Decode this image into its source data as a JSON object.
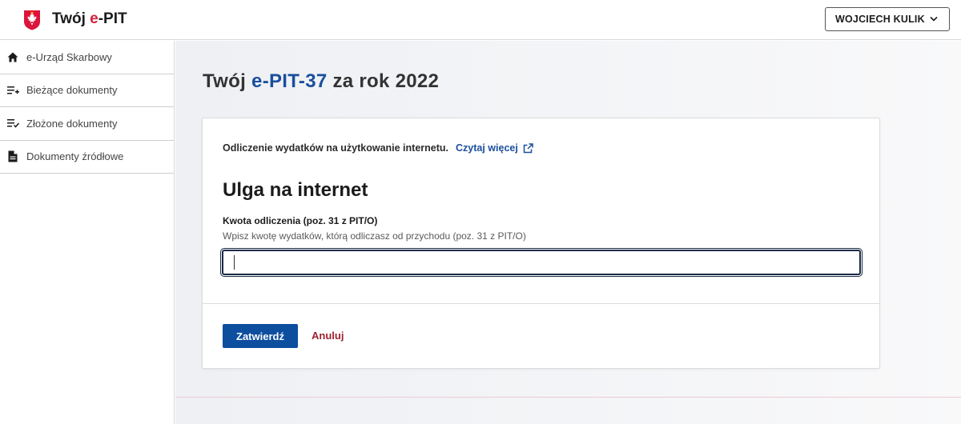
{
  "header": {
    "logo_prefix": "Twój ",
    "logo_accent": "e",
    "logo_suffix": "-PIT",
    "logo_icon": "polish-eagle-emblem",
    "user_name": "WOJCIECH KULIK",
    "user_menu_icon": "chevron-down-icon"
  },
  "sidebar": {
    "items": [
      {
        "label": "e-Urząd Skarbowy",
        "icon": "home-icon"
      },
      {
        "label": "Bieżące dokumenty",
        "icon": "list-add-icon"
      },
      {
        "label": "Złożone dokumenty",
        "icon": "list-check-icon"
      },
      {
        "label": "Dokumenty źródłowe",
        "icon": "document-icon"
      }
    ]
  },
  "main": {
    "title_prefix": "Twój ",
    "title_form_a": "e-PIT-",
    "title_form_b": "37",
    "title_suffix": " za rok 2022",
    "card": {
      "info_text": "Odliczenie wydatków na użytkowanie internetu.",
      "read_more": "Czytaj więcej",
      "read_more_icon": "external-link-icon",
      "section_title": "Ulga na internet",
      "field_label": "Kwota odliczenia (poz. 31 z PIT/O)",
      "field_hint": "Wpisz kwotę wydatków, którą odliczasz od przychodu (poz. 31 z PIT/O)",
      "field_value": "",
      "submit_label": "Zatwierdź",
      "cancel_label": "Anuluj"
    }
  },
  "colors": {
    "accent_blue": "#0d4e9f",
    "brand_red": "#d4213d",
    "cancel_red": "#9c2230"
  }
}
